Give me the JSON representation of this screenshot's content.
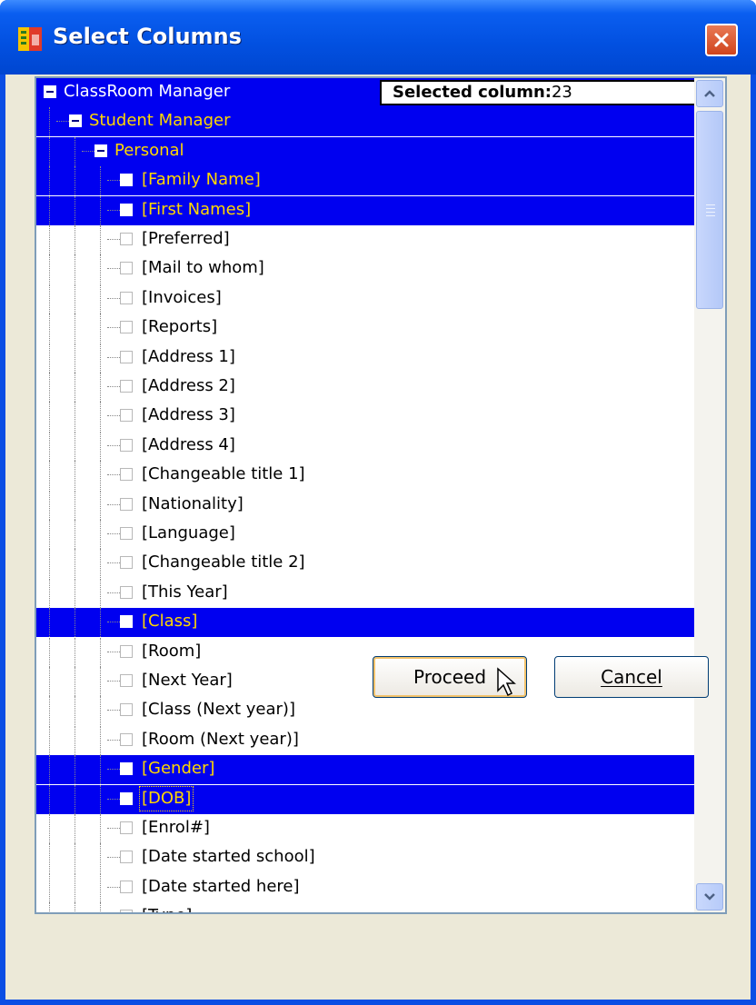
{
  "window": {
    "title": "Select Columns",
    "icons": {
      "app": "app-icon",
      "close": "close-icon"
    }
  },
  "tree": {
    "selected_count_label": "Selected column:",
    "selected_count_value": "23",
    "rows": [
      {
        "label": "ClassRoom Manager",
        "level": 0,
        "type": "group",
        "selected": true
      },
      {
        "label": "Student Manager",
        "level": 1,
        "type": "group",
        "selected": true
      },
      {
        "label": "Personal",
        "level": 2,
        "type": "group",
        "selected": true
      },
      {
        "label": "[Family Name]",
        "level": 3,
        "type": "item",
        "selected": true
      },
      {
        "label": "[First Names]",
        "level": 3,
        "type": "item",
        "selected": true
      },
      {
        "label": "[Preferred]",
        "level": 3,
        "type": "item",
        "selected": false
      },
      {
        "label": "[Mail to whom]",
        "level": 3,
        "type": "item",
        "selected": false
      },
      {
        "label": "[Invoices]",
        "level": 3,
        "type": "item",
        "selected": false
      },
      {
        "label": "[Reports]",
        "level": 3,
        "type": "item",
        "selected": false
      },
      {
        "label": "[Address 1]",
        "level": 3,
        "type": "item",
        "selected": false
      },
      {
        "label": "[Address 2]",
        "level": 3,
        "type": "item",
        "selected": false
      },
      {
        "label": "[Address 3]",
        "level": 3,
        "type": "item",
        "selected": false
      },
      {
        "label": "[Address 4]",
        "level": 3,
        "type": "item",
        "selected": false
      },
      {
        "label": "[Changeable title 1]",
        "level": 3,
        "type": "item",
        "selected": false
      },
      {
        "label": "[Nationality]",
        "level": 3,
        "type": "item",
        "selected": false
      },
      {
        "label": "[Language]",
        "level": 3,
        "type": "item",
        "selected": false
      },
      {
        "label": "[Changeable title 2]",
        "level": 3,
        "type": "item",
        "selected": false
      },
      {
        "label": "[This Year]",
        "level": 3,
        "type": "item",
        "selected": false
      },
      {
        "label": "[Class]",
        "level": 3,
        "type": "item",
        "selected": true
      },
      {
        "label": "[Room]",
        "level": 3,
        "type": "item",
        "selected": false
      },
      {
        "label": "[Next Year]",
        "level": 3,
        "type": "item",
        "selected": false
      },
      {
        "label": "[Class (Next year)]",
        "level": 3,
        "type": "item",
        "selected": false
      },
      {
        "label": "[Room (Next year)]",
        "level": 3,
        "type": "item",
        "selected": false
      },
      {
        "label": "[Gender]",
        "level": 3,
        "type": "item",
        "selected": true
      },
      {
        "label": "[DOB]",
        "level": 3,
        "type": "item",
        "selected": true,
        "focused": true
      },
      {
        "label": "[Enrol#]",
        "level": 3,
        "type": "item",
        "selected": false
      },
      {
        "label": "[Date started school]",
        "level": 3,
        "type": "item",
        "selected": false
      },
      {
        "label": "[Date started here]",
        "level": 3,
        "type": "item",
        "selected": false
      },
      {
        "label": "[Type]",
        "level": 3,
        "type": "item",
        "selected": false
      }
    ],
    "scroll_position": 0.0
  },
  "buttons": {
    "proceed": "Proceed",
    "cancel": "Cancel"
  },
  "colors": {
    "selection": "#0000f0",
    "selected_text": "#ffd700",
    "title_bar": "#0250e0",
    "dialog_bg": "#ece9d8"
  }
}
